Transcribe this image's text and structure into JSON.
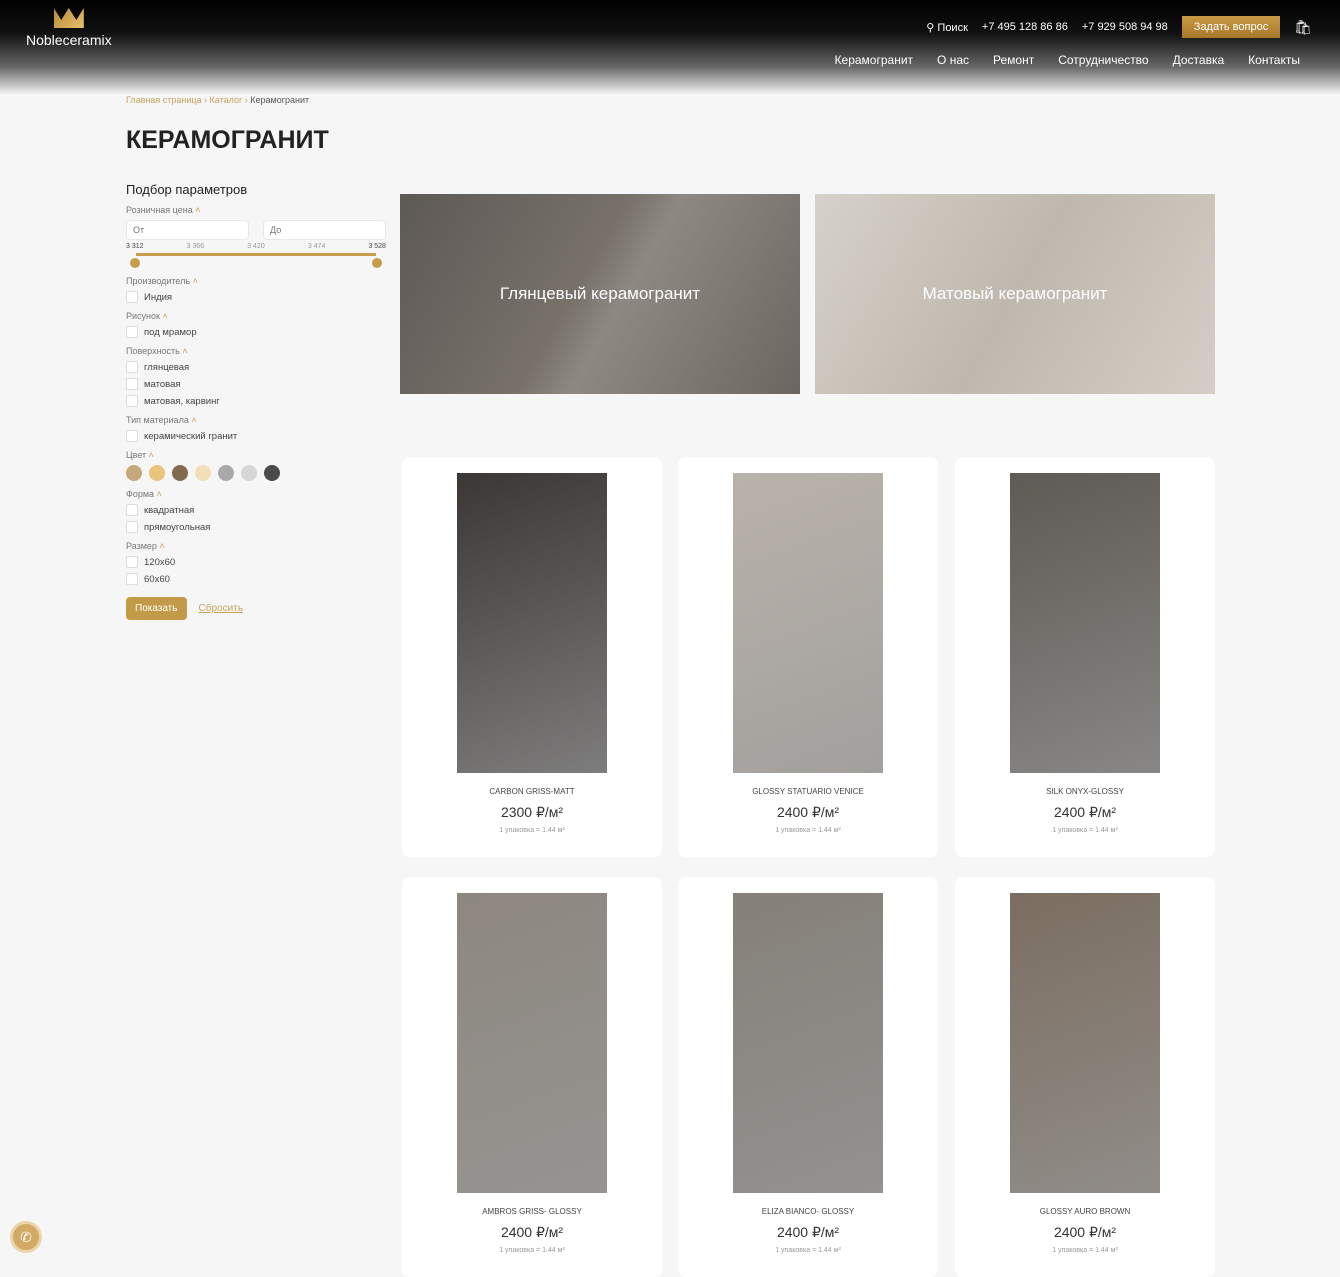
{
  "header": {
    "logo": "Nobleceramix",
    "search": "Поиск",
    "phone1": "+7 495 128 86 86",
    "phone2": "+7 929 508 94 98",
    "ask": "Задать вопрос",
    "nav": [
      "Керамогранит",
      "О нас",
      "Ремонт",
      "Сотрудничество",
      "Доставка",
      "Контакты"
    ]
  },
  "breadcrumb": [
    "Главная страница",
    "Каталог",
    "Керамогранит"
  ],
  "title": "КЕРАМОГРАНИТ",
  "filters": {
    "title": "Подбор параметров",
    "price_label": "Розничная цена",
    "from": "От",
    "to": "До",
    "ticks": [
      "3 312",
      "3 366",
      "3 420",
      "3 474",
      "3 528"
    ],
    "manufacturer": {
      "label": "Производитель",
      "options": [
        "Индия"
      ]
    },
    "pattern": {
      "label": "Рисунок",
      "options": [
        "под мрамор"
      ]
    },
    "surface": {
      "label": "Поверхность",
      "options": [
        "глянцевая",
        "матовая",
        "матовая, карвинг"
      ]
    },
    "material": {
      "label": "Тип материала",
      "options": [
        "керамический гранит"
      ]
    },
    "color": {
      "label": "Цвет",
      "swatches": [
        "#c4a77a",
        "#e9c47c",
        "#826a4e",
        "#f3dfb5",
        "#a9a9a9",
        "#d6d6d6",
        "#4a4a4a"
      ]
    },
    "shape": {
      "label": "Форма",
      "options": [
        "квадратная",
        "прямоугольная"
      ]
    },
    "size": {
      "label": "Размер",
      "options": [
        "120x60",
        "60x60"
      ]
    },
    "show": "Показать",
    "reset": "Сбросить"
  },
  "banners": [
    "Глянцевый керамогранит",
    "Матовый керамогранит"
  ],
  "products": [
    {
      "name": "CARBON GRISS-MATT",
      "price": "2300 ₽/м²",
      "pack": "1 упаковка = 1.44 м²",
      "color": "#3a3735"
    },
    {
      "name": "GLOSSY STATUARIO VENICE",
      "price": "2400 ₽/м²",
      "pack": "1 упаковка = 1.44 м²",
      "color": "#b9b2aa"
    },
    {
      "name": "SILK ONYX-GLOSSY",
      "price": "2400 ₽/м²",
      "pack": "1 упаковка = 1.44 м²",
      "color": "#5e5a54"
    },
    {
      "name": "AMBROS GRISS- GLOSSY",
      "price": "2400 ₽/м²",
      "pack": "1 упаковка = 1.44 м²",
      "color": "#8d877f"
    },
    {
      "name": "ELIZA BIANCO- GLOSSY",
      "price": "2400 ₽/м²",
      "pack": "1 упаковка = 1.44 м²",
      "color": "#858079"
    },
    {
      "name": "GLOSSY AURO BROWN",
      "price": "2400 ₽/м²",
      "pack": "1 упаковка = 1.44 м²",
      "color": "#7b6e60"
    }
  ]
}
